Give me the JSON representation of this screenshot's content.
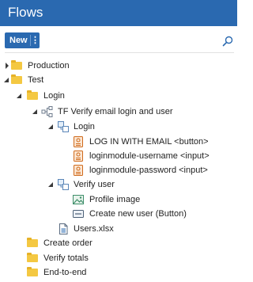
{
  "header": {
    "title": "Flows",
    "bg_color": "#2a69b0"
  },
  "toolbar": {
    "new_label": "New",
    "menu_glyph": "⋮",
    "search_icon": "search-icon"
  },
  "tree": {
    "production": "Production",
    "test": "Test",
    "login": "Login",
    "flow": "TF Verify email login and user",
    "sub_login": "Login",
    "log_in_button": "LOG IN WITH EMAIL <button>",
    "username_input": "loginmodule-username <input>",
    "password_input": "loginmodule-password <input>",
    "verify_user": "Verify user",
    "profile_image": "Profile image",
    "create_user": "Create new user (Button)",
    "users_xlsx": "Users.xlsx",
    "create_order": "Create order",
    "verify_totals": "Verify totals",
    "end_to_end": "End-to-end"
  }
}
